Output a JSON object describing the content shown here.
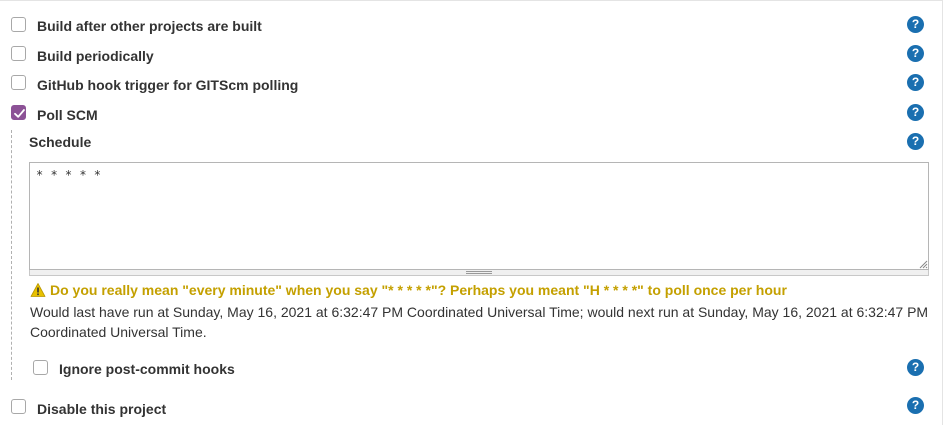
{
  "triggers": {
    "build_after": {
      "label": "Build after other projects are built",
      "checked": false
    },
    "build_periodically": {
      "label": "Build periodically",
      "checked": false
    },
    "github_hook": {
      "label": "GitHub hook trigger for GITScm polling",
      "checked": false
    },
    "poll_scm": {
      "label": "Poll SCM",
      "checked": true
    }
  },
  "poll_scm": {
    "schedule_label": "Schedule",
    "schedule_value": "* * * * *",
    "warning": "Do you really mean \"every minute\" when you say \"* * * * *\"? Perhaps you meant \"H * * * *\" to poll once per hour",
    "info": "Would last have run at Sunday, May 16, 2021 at 6:32:47 PM Coordinated Universal Time; would next run at Sunday, May 16, 2021 at 6:32:47 PM Coordinated Universal Time.",
    "ignore_post_commit": {
      "label": "Ignore post-commit hooks",
      "checked": false
    }
  },
  "disable_project": {
    "label": "Disable this project",
    "checked": false
  },
  "help_glyph": "?",
  "colors": {
    "accent_checkbox": "#8c5296",
    "help_icon": "#1a6fb0",
    "warning_text": "#c4a000"
  },
  "icons": {
    "help": "help-icon",
    "warning": "warning-icon",
    "checkmark": "checkmark-icon"
  }
}
